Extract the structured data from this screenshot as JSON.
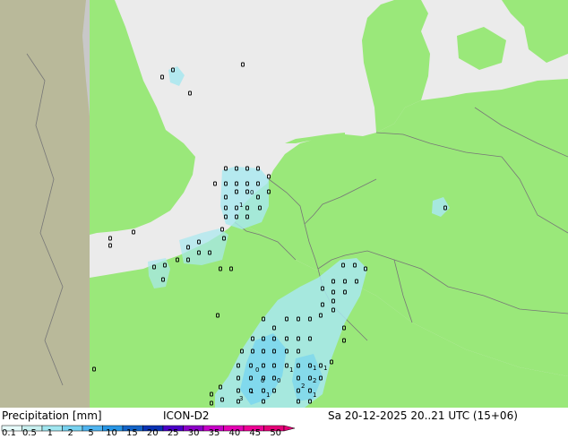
{
  "map": {
    "colors": {
      "land": "#9ae87a",
      "sea": "#ebebeb",
      "outside_domain": "#c8c8c8",
      "uk_inland": "#b9b99a",
      "precip_light": "#a8e8f0",
      "precip_medium": "#78d4f0",
      "borders": "#777777"
    },
    "precip_digits": [
      "0",
      "1",
      "0",
      "1",
      "2",
      "1",
      "3",
      "0",
      "1",
      "1",
      "0",
      "1",
      "2",
      "1"
    ]
  },
  "legend": {
    "title": "Precipitation [mm]",
    "model": "ICON-D2",
    "valid_time": "Sa 20-12-2025 20..21 UTC (15+06)",
    "ticks": [
      "0.1",
      "0.5",
      "1",
      "2",
      "5",
      "10",
      "15",
      "20",
      "25",
      "30",
      "35",
      "40",
      "45",
      "50"
    ],
    "colors": [
      "#e6fafa",
      "#c8f0f0",
      "#a0e6f0",
      "#78d2f0",
      "#50b4f0",
      "#2896e6",
      "#1464c8",
      "#0a32b4",
      "#4b00c8",
      "#8c00c8",
      "#c800c8",
      "#e600b4",
      "#f00096",
      "#e60078"
    ]
  }
}
